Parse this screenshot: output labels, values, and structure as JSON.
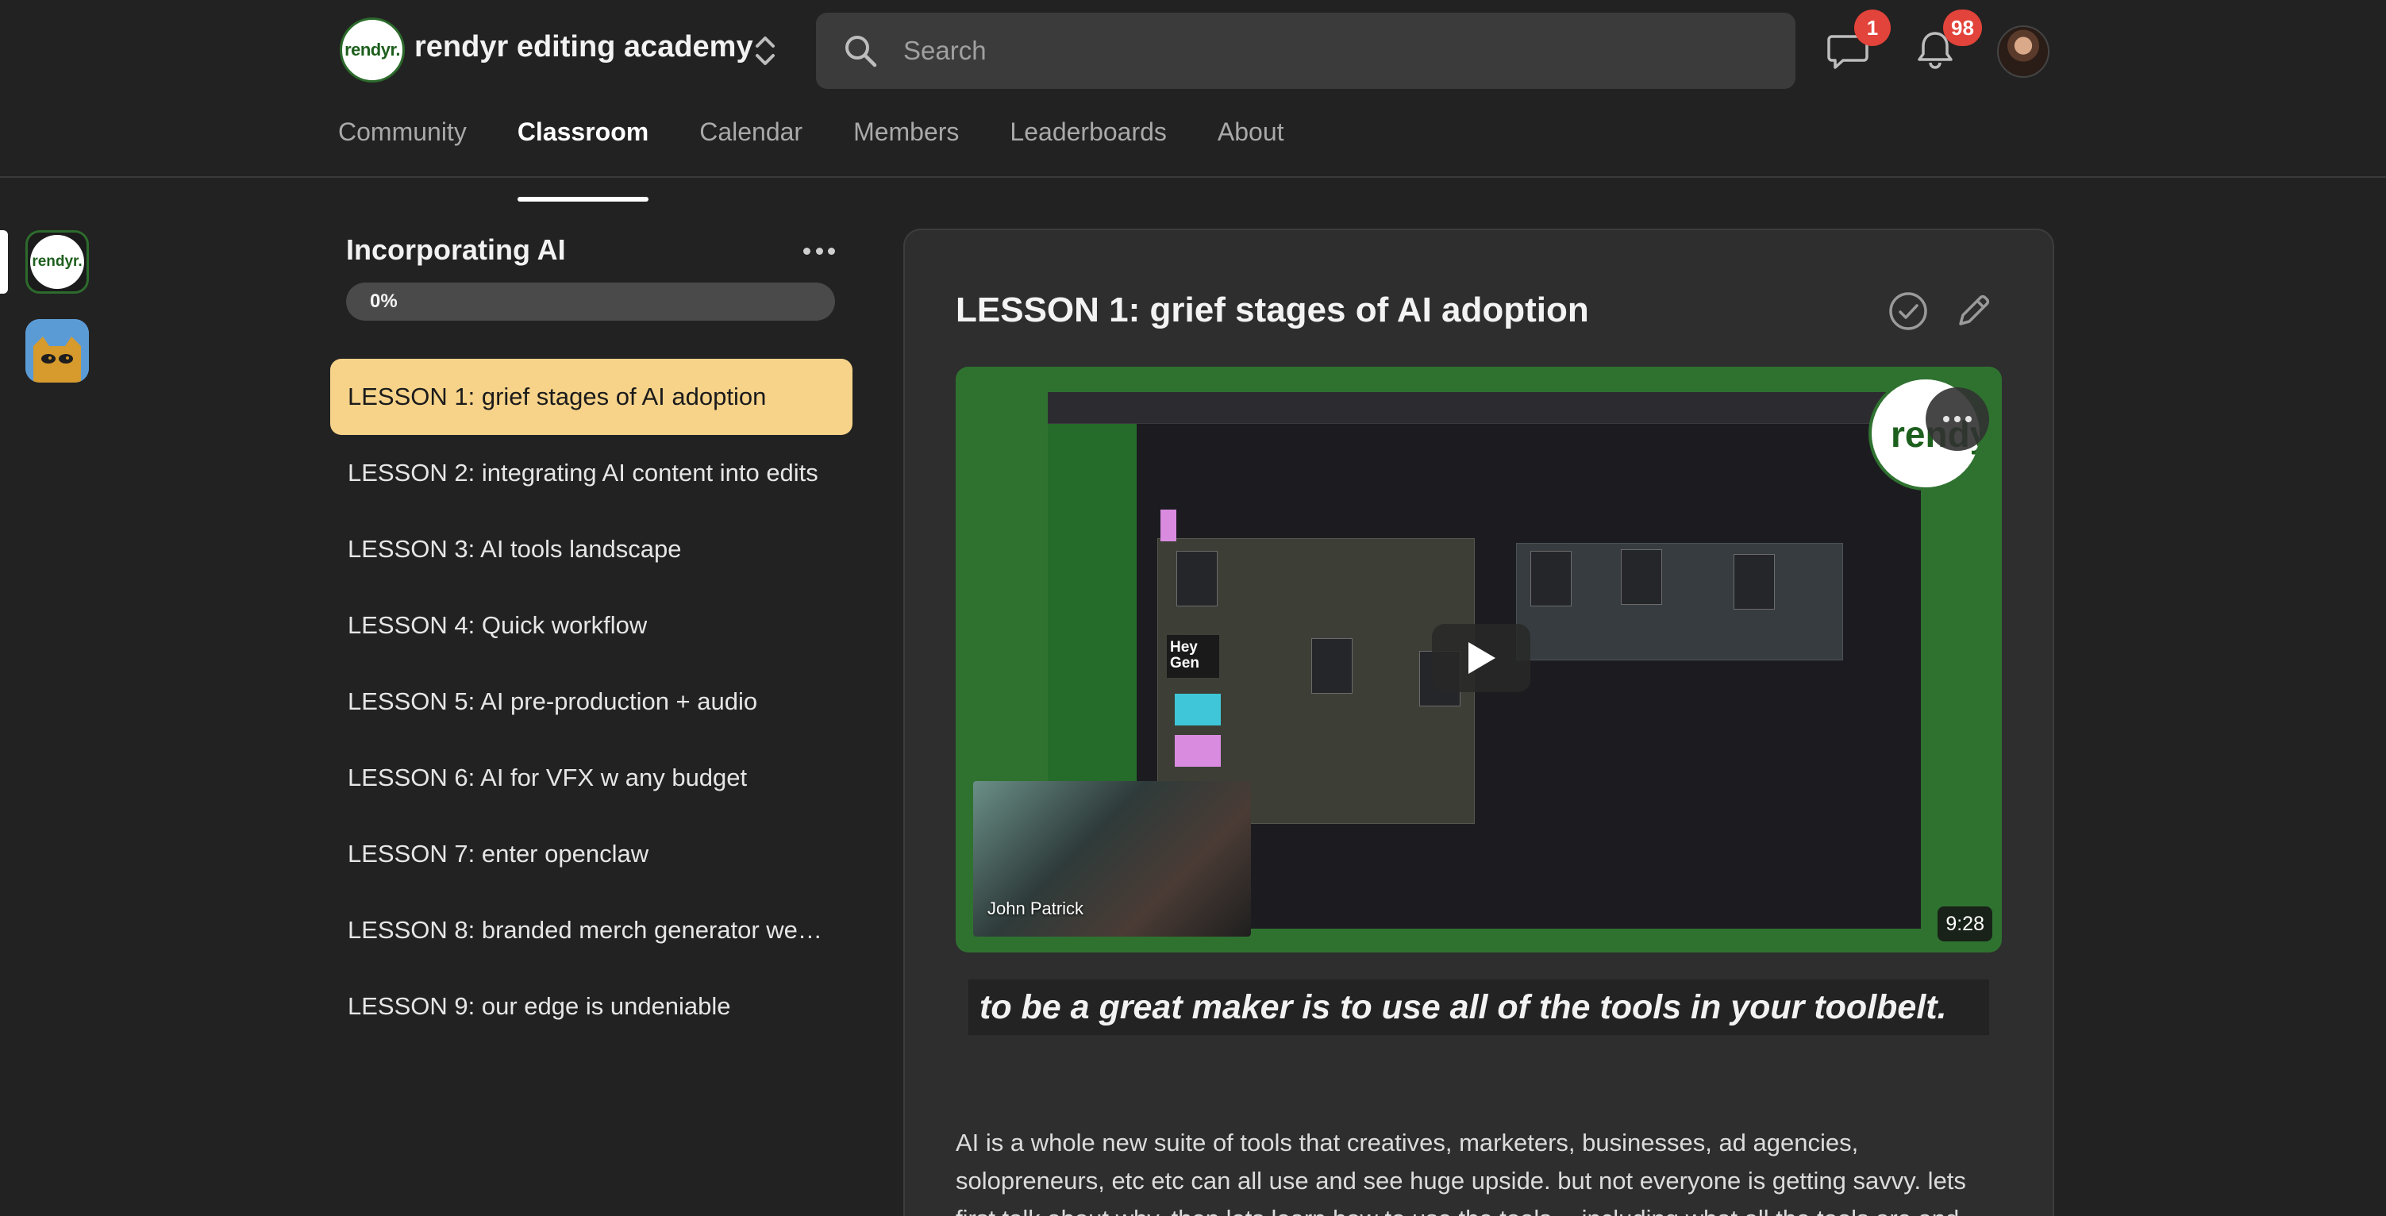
{
  "header": {
    "group_logo_text": "rendyr.",
    "group_name": "rendyr editing academy",
    "search_placeholder": "Search",
    "chat_badge": "1",
    "notifications_badge": "98"
  },
  "tabs": [
    {
      "label": "Community",
      "active": false
    },
    {
      "label": "Classroom",
      "active": true
    },
    {
      "label": "Calendar",
      "active": false
    },
    {
      "label": "Members",
      "active": false
    },
    {
      "label": "Leaderboards",
      "active": false
    },
    {
      "label": "About",
      "active": false
    }
  ],
  "rail": {
    "item1_text": "rendyr."
  },
  "course": {
    "title": "Incorporating AI",
    "progress_label": "0%",
    "progress": 0,
    "lessons": [
      "LESSON 1: grief stages of AI adoption",
      "LESSON 2: integrating AI content into edits",
      "LESSON 3: AI tools landscape",
      "LESSON 4: Quick workflow",
      "LESSON 5: AI pre-production + audio",
      "LESSON 6: AI for VFX w any budget",
      "LESSON 7: enter openclaw",
      "LESSON 8: branded merch generator wea…",
      "LESSON 9: our edge is undeniable"
    ],
    "active_lesson_index": 0
  },
  "main": {
    "lesson_title": "LESSON 1: grief stages of AI adoption",
    "video": {
      "presenter_name": "John Patrick",
      "duration": "9:28",
      "watermark_text": "rendy",
      "heygen_label": "Hey Gen"
    },
    "quote": "to be a great maker is to use all of the tools in your toolbelt.",
    "body": "AI is a whole new suite of tools that creatives, marketers, businesses, ad agencies, solopreneurs, etc etc can all use and see huge upside. but not everyone is getting savvy. lets first talk about why, then lets learn how to use the tools -- including what all the tools are and"
  },
  "colors": {
    "background": "#222222",
    "card": "#2e2e2e",
    "active_lesson": "#f7d38a",
    "badge": "#e2433a",
    "brand_green": "#2f7230"
  }
}
